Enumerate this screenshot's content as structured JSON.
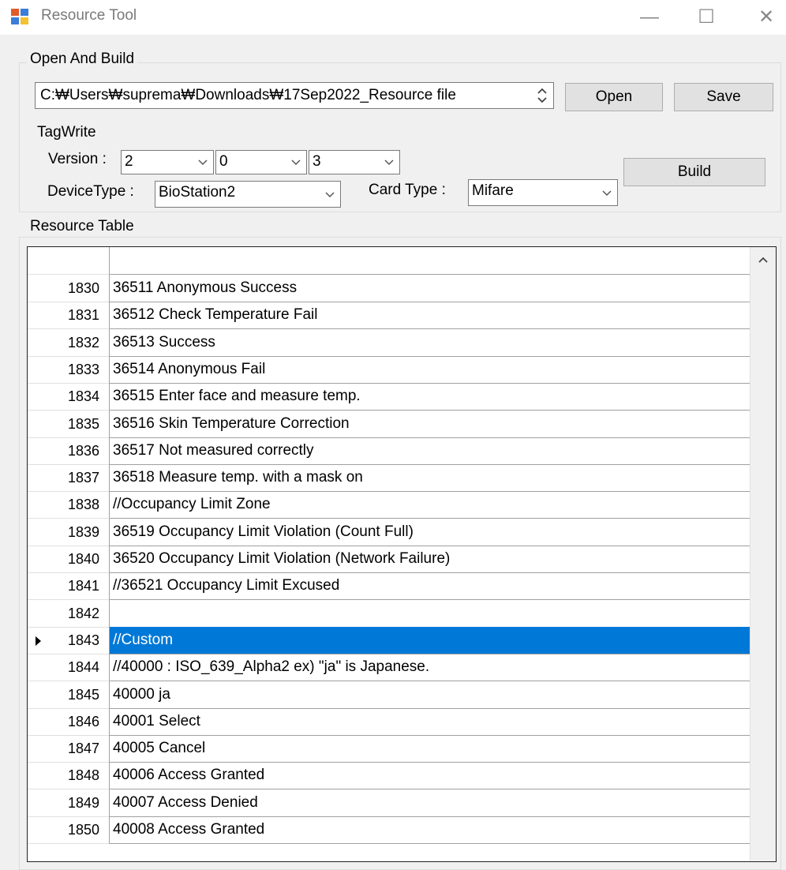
{
  "window": {
    "title": "Resource Tool",
    "min_glyph": "—",
    "max_glyph": "☐",
    "close_glyph": "✕"
  },
  "open_build": {
    "group_label": "Open And Build",
    "path_value": "C:₩Users₩suprema₩Downloads₩17Sep2022_Resource file",
    "open_label": "Open",
    "save_label": "Save",
    "tagwrite_label": "TagWrite",
    "version_label": "Version :",
    "version_values": [
      "2",
      "0",
      "3"
    ],
    "device_type_label": "DeviceType :",
    "device_type_value": "BioStation2",
    "card_type_label": "Card Type :",
    "card_type_value": "Mifare",
    "build_label": "Build"
  },
  "resource_table": {
    "group_label": "Resource Table",
    "selected_row": "1843",
    "rows": [
      {
        "num": "1830",
        "text": "36511 Anonymous Success"
      },
      {
        "num": "1831",
        "text": "36512 Check Temperature Fail"
      },
      {
        "num": "1832",
        "text": "36513 Success"
      },
      {
        "num": "1833",
        "text": "36514 Anonymous Fail"
      },
      {
        "num": "1834",
        "text": "36515 Enter face and measure temp."
      },
      {
        "num": "1835",
        "text": "36516 Skin Temperature Correction"
      },
      {
        "num": "1836",
        "text": "36517 Not measured correctly"
      },
      {
        "num": "1837",
        "text": "36518 Measure temp. with a mask on"
      },
      {
        "num": "1838",
        "text": "//Occupancy Limit Zone"
      },
      {
        "num": "1839",
        "text": "36519 Occupancy Limit Violation (Count Full)"
      },
      {
        "num": "1840",
        "text": "36520 Occupancy Limit Violation (Network Failure)"
      },
      {
        "num": "1841",
        "text": "//36521 Occupancy Limit Excused"
      },
      {
        "num": "1842",
        "text": ""
      },
      {
        "num": "1843",
        "text": "//Custom"
      },
      {
        "num": "1844",
        "text": "//40000 : ISO_639_Alpha2 ex) \"ja\" is Japanese."
      },
      {
        "num": "1845",
        "text": "40000 ja"
      },
      {
        "num": "1846",
        "text": "40001 Select"
      },
      {
        "num": "1847",
        "text": "40005 Cancel"
      },
      {
        "num": "1848",
        "text": "40006 Access Granted"
      },
      {
        "num": "1849",
        "text": "40007 Access Denied"
      },
      {
        "num": "1850",
        "text": "40008 Access Granted"
      }
    ]
  }
}
